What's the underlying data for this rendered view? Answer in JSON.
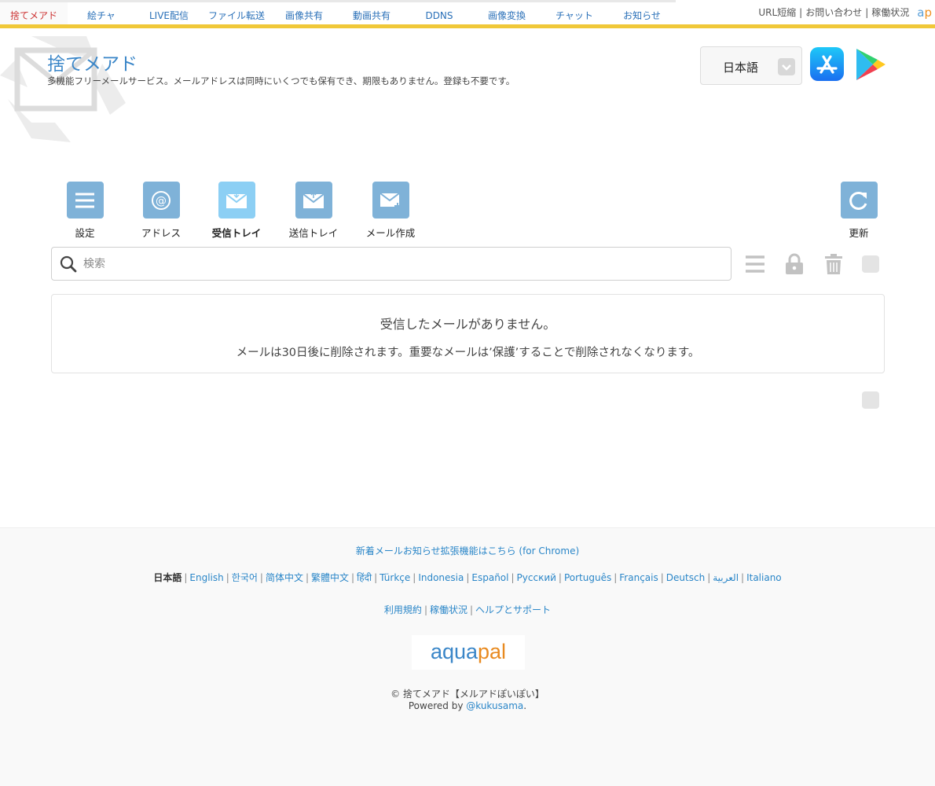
{
  "nav": {
    "tabs": [
      "捨てメアド",
      "絵チャ",
      "LIVE配信",
      "ファイル転送",
      "画像共有",
      "動画共有",
      "DDNS",
      "画像変換",
      "チャット",
      "お知らせ"
    ],
    "active_index": 0,
    "right_links": [
      "URL短縮",
      "お問い合わせ",
      "稼働状況"
    ],
    "brand_a": "a",
    "brand_p": "p"
  },
  "header": {
    "title": "捨てメアド",
    "subtitle": "多機能フリーメールサービス。メールアドレスは同時にいくつでも保有でき、期限もありません。登録も不要です。",
    "language": "日本語"
  },
  "toolbar": {
    "settings": "設定",
    "address": "アドレス",
    "inbox": "受信トレイ",
    "outbox": "送信トレイ",
    "compose": "メール作成",
    "refresh": "更新"
  },
  "search": {
    "placeholder": "検索",
    "value": ""
  },
  "empty": {
    "line1": "受信したメールがありません。",
    "line2": "メールは30日後に削除されます。重要なメールは’保護’することで削除されなくなります。"
  },
  "footer": {
    "extension": "新着メールお知らせ拡張機能はこちら (for Chrome)",
    "current_language": "日本語",
    "languages": [
      "English",
      "한국어",
      "简体中文",
      "繁體中文",
      "हिंदी",
      "Türkçe",
      "Indonesia",
      "Español",
      "Русский",
      "Português",
      "Français",
      "Deutsch",
      "العربية",
      "Italiano"
    ],
    "links": [
      "利用規約",
      "稼働状況",
      "ヘルプとサポート"
    ],
    "aquapal_1": "aqua",
    "aquapal_2": "pal",
    "copyright": "© 捨てメアド【メルアドぽいぽい】",
    "powered_prefix": "Powered by ",
    "powered_link": "@kukusama",
    "powered_suffix": "."
  },
  "colors": {
    "accent": "#f0c838",
    "link": "#2a86c8",
    "tool_icon": "#7fb2d8",
    "tool_icon_active": "#8ccff4"
  }
}
